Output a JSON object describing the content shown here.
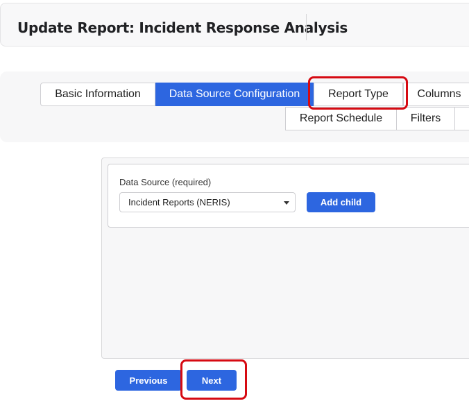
{
  "header": {
    "title": "Update Report: Incident Response Analysis"
  },
  "tabs": {
    "row1": [
      {
        "label": "Basic Information",
        "active": false
      },
      {
        "label": "Data Source Configuration",
        "active": true
      },
      {
        "label": "Report Type",
        "active": false
      },
      {
        "label": "Columns",
        "active": false
      }
    ],
    "row2": [
      {
        "label": "Report Schedule",
        "active": false
      },
      {
        "label": "Filters",
        "active": false
      }
    ]
  },
  "form": {
    "data_source_label": "Data Source (required)",
    "data_source_value": "Incident Reports (NERIS)",
    "add_child_label": "Add child"
  },
  "nav": {
    "previous_label": "Previous",
    "next_label": "Next"
  },
  "colors": {
    "accent": "#2d66e0",
    "highlight": "#d60a12"
  }
}
